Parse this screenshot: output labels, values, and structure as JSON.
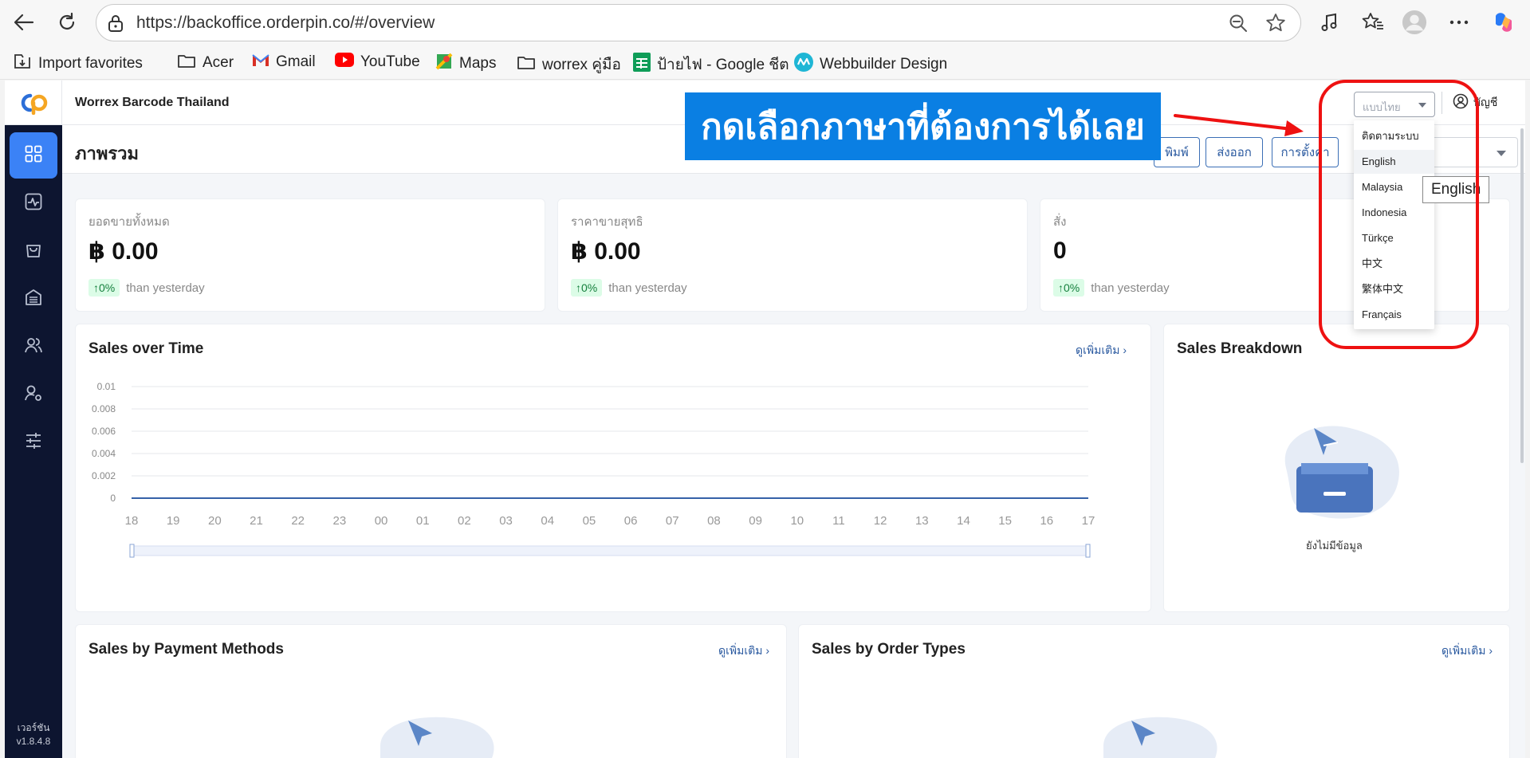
{
  "browser": {
    "url": "https://backoffice.orderpin.co/#/overview",
    "bookmarks": [
      {
        "label": "Import favorites",
        "icon": "import-icon"
      },
      {
        "label": "Acer",
        "icon": "folder-icon"
      },
      {
        "label": "Gmail",
        "icon": "gmail-icon"
      },
      {
        "label": "YouTube",
        "icon": "youtube-icon"
      },
      {
        "label": "Maps",
        "icon": "maps-icon"
      },
      {
        "label": "worrex คู่มือ",
        "icon": "folder-icon"
      },
      {
        "label": "ป้ายไฟ - Google ชีต",
        "icon": "sheets-icon"
      },
      {
        "label": "Webbuilder Design",
        "icon": "webbuilder-icon"
      }
    ]
  },
  "app": {
    "company": "Worrex Barcode Thailand",
    "language_select": "แบบไทย",
    "account_label": "บัญชี",
    "version": [
      "เวอร์ชัน",
      "v1.8.4.8"
    ],
    "page_title": "ภาพรวม",
    "toolbar": {
      "print": "พิมพ์",
      "export": "ส่งออก",
      "settings": "การตั้งค่า"
    },
    "stats": [
      {
        "label": "ยอดขายทั้งหมด",
        "value": "฿ 0.00",
        "delta": "↑0%",
        "note": "than yesterday"
      },
      {
        "label": "ราคาขายสุทธิ",
        "value": "฿ 0.00",
        "delta": "↑0%",
        "note": "than yesterday"
      },
      {
        "label": "สั่ง",
        "value": "0",
        "delta": "↑0%",
        "note": "than yesterday"
      }
    ],
    "sales_over_time": {
      "title": "Sales over Time",
      "more": "ดูเพิ่มเติม"
    },
    "sales_breakdown": {
      "title": "Sales Breakdown",
      "empty": "ยังไม่มีข้อมูล"
    },
    "sales_by_payment": {
      "title": "Sales by Payment Methods",
      "more": "ดูเพิ่มเติม"
    },
    "sales_by_order_types": {
      "title": "Sales by Order Types",
      "more": "ดูเพิ่มเติม"
    },
    "language_dropdown": {
      "options": [
        "ติดตามระบบ",
        "English",
        "Malaysia",
        "Indonesia",
        "Türkçe",
        "中文",
        "繁体中文",
        "Français"
      ],
      "hovered": "English",
      "tooltip": "English"
    }
  },
  "annotation": {
    "banner": "กดเลือกภาษาที่ต้องการได้เลย"
  },
  "colors": {
    "sidebar": "#0d1530",
    "accent": "#3b82f6",
    "banner": "#0a7fe3",
    "annotation_red": "#e11111"
  },
  "chart_data": {
    "type": "line",
    "title": "Sales over Time",
    "x": [
      "18",
      "19",
      "20",
      "21",
      "22",
      "23",
      "00",
      "01",
      "02",
      "03",
      "04",
      "05",
      "06",
      "07",
      "08",
      "09",
      "10",
      "11",
      "12",
      "13",
      "14",
      "15",
      "16",
      "17"
    ],
    "series": [
      {
        "values": [
          0,
          0,
          0,
          0,
          0,
          0,
          0,
          0,
          0,
          0,
          0,
          0,
          0,
          0,
          0,
          0,
          0,
          0,
          0,
          0,
          0,
          0,
          0,
          0
        ]
      }
    ],
    "yticks": [
      "0.01",
      "0.008",
      "0.006",
      "0.004",
      "0.002",
      "0"
    ],
    "ylim": [
      0,
      0.01
    ],
    "grid": true
  }
}
